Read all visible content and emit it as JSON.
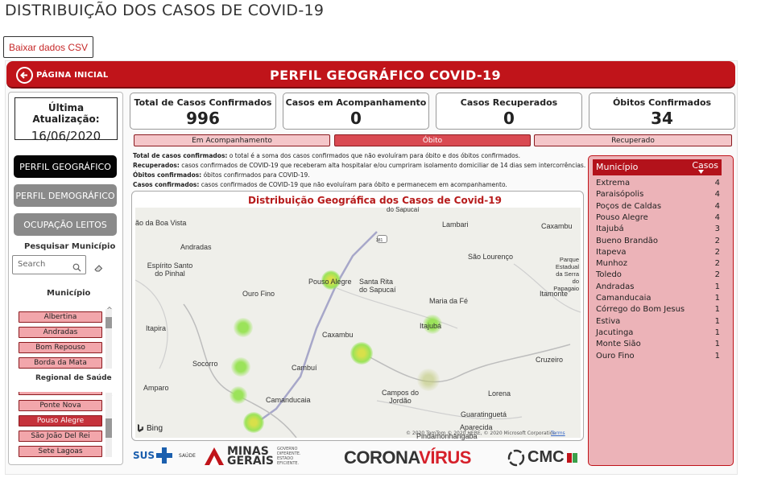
{
  "page_title": "DISTRIBUIÇÃO DOS CASOS DE COVID-19",
  "csv_button": "Baixar dados CSV",
  "banner": {
    "home_label": "PÁGINA INICIAL",
    "title": "PERFIL GEOGRÁFICO COVID-19"
  },
  "update": {
    "label": "Última Atualização:",
    "date": "16/06/2020"
  },
  "nav": {
    "geo": "PERFIL GEOGRÁFICO",
    "demo": "PERFIL DEMOGRÁFICO",
    "occ": "OCUPAÇÃO LEITOS"
  },
  "search": {
    "heading": "Pesquisar Município",
    "placeholder": "Search"
  },
  "municipio_slicer": {
    "heading": "Município",
    "items": [
      "Albertina",
      "Andradas",
      "Bom Repouso",
      "Borda da Mata"
    ]
  },
  "regional_slicer": {
    "heading": "Regional de Saúde",
    "items": [
      "Ponte Nova",
      "Pouso Alegre",
      "São João Del Rei",
      "Sete Lagoas"
    ]
  },
  "kpis": [
    {
      "label": "Total de Casos Confirmados",
      "value": "996"
    },
    {
      "label": "Casos em Acompanhamento",
      "value": "0"
    },
    {
      "label": "Casos Recuperados",
      "value": "0"
    },
    {
      "label": "Óbitos Confirmados",
      "value": "34"
    }
  ],
  "status_buttons": [
    "Em Acompanhamento",
    "Óbito",
    "Recuperado"
  ],
  "definitions": [
    {
      "term": "Total de  casos confirmados:",
      "text": " o total é a soma dos casos confirmados que não evoluíram para óbito e  dos óbitos confirmados."
    },
    {
      "term": "Recuperados:",
      "text": " casos confirmados de COVID-19 que receberam alta hospitalar e/ou cumpriram isolamento domiciliar de 14 dias sem intercorrências."
    },
    {
      "term": "Óbitos confirmados:",
      "text": " óbitos confirmados para COVID-19."
    },
    {
      "term": "Casos confirmados:",
      "text": " casos confirmados de COVID-19 que  não evoluíram para óbito e permanecem em acompanhamento."
    }
  ],
  "map": {
    "title": "Distribuição Geográfica dos Casos de Covid-19",
    "places": [
      "ão da Boa Vista",
      "do Sapucaí",
      "Lambari",
      "Caxambu",
      "Andradas",
      "381",
      "São Lourenço",
      "Parque Estadual da Serra do Papagaio",
      "Espírito Santo do Pinhal",
      "Ouro Fino",
      "Pouso Alegre",
      "Santa Rita do Sapucaí",
      "Maria da Fé",
      "Itamonte",
      "Itapira",
      "Caxambu",
      "Itajubá",
      "Socorro",
      "Cambuí",
      "Cruzeiro",
      "Amparo",
      "Campos do Jordão",
      "Lorena",
      "Camanducaia",
      "Guaratinguetá",
      "Aparecida",
      "Pindamonhangaba"
    ],
    "provider": "Bing",
    "copyright": "© 2020 TomTom © 2020 HERE, © 2020 Microsoft Corporation",
    "terms": "Terms"
  },
  "table": {
    "headers": [
      "Município",
      "Casos"
    ],
    "rows": [
      [
        "Extrema",
        "4"
      ],
      [
        "Paraisópolis",
        "4"
      ],
      [
        "Poços de Caldas",
        "4"
      ],
      [
        "Pouso Alegre",
        "4"
      ],
      [
        "Itajubá",
        "3"
      ],
      [
        "Bueno Brandão",
        "2"
      ],
      [
        "Itapeva",
        "2"
      ],
      [
        "Munhoz",
        "2"
      ],
      [
        "Toledo",
        "2"
      ],
      [
        "Andradas",
        "1"
      ],
      [
        "Camanducaia",
        "1"
      ],
      [
        "Córrego do Bom Jesus",
        "1"
      ],
      [
        "Estiva",
        "1"
      ],
      [
        "Jacutinga",
        "1"
      ],
      [
        "Monte Sião",
        "1"
      ],
      [
        "Ouro Fino",
        "1"
      ]
    ]
  },
  "logos": {
    "sus": "SUS",
    "saude": "SAÚDE",
    "minas1": "MINAS",
    "minas2": "GERAIS",
    "governo": "GOVERNO DIFERENTE. ESTADO EFICIENTE.",
    "corona1": "CORONA",
    "corona2": "VÍRUS",
    "cmc": "CMC"
  },
  "colors": {
    "accent": "#c0141a",
    "table_bg": "#ecb3b8",
    "map_hotspot": "#9be35a"
  }
}
